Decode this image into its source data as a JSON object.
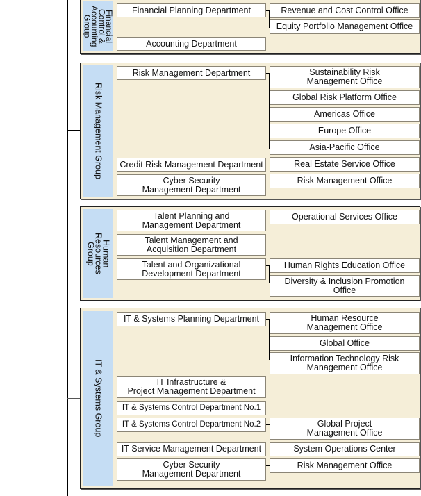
{
  "groups": [
    {
      "name": "Financial\nControl &\nAccounting\nGroup",
      "departments": [
        "Financial Planning Department",
        "Accounting Department"
      ],
      "offices": [
        "Revenue and Cost Control Office",
        "Equity Portfolio Management Office"
      ]
    },
    {
      "name": "Risk Management Group",
      "departments": [
        "Risk Management Department",
        "Credit Risk Management Department",
        "Cyber Security\nManagement Department"
      ],
      "offices": [
        "Sustainability Risk\nManagement Office",
        "Global Risk Platform Office",
        "Americas Office",
        "Europe Office",
        "Asia-Pacific Office",
        "Real Estate Service Office",
        "Risk Management Office"
      ]
    },
    {
      "name": "Human\nResources\nGroup",
      "departments": [
        "Talent Planning  and\nManagement Department",
        "Talent Management and\nAcquisition Department",
        "Talent and Organizational\nDevelopment Department"
      ],
      "offices": [
        "Operational Services Office",
        "Human Rights Education Office",
        "Diversity & Inclusion Promotion\nOffice"
      ]
    },
    {
      "name": "IT & Systems Group",
      "departments": [
        "IT & Systems Planning Department",
        "IT Infrastructure &\nProject Management Department",
        "IT & Systems Control Department No.1",
        "IT & Systems Control Department No.2",
        "IT Service Management Department",
        "Cyber Security\nManagement Department"
      ],
      "offices": [
        "Human Resource\nManagement Office",
        "Global Office",
        "Information Technology Risk\nManagement Office",
        "Global Project\nManagement Office",
        "System Operations Center",
        "Risk Management Office"
      ]
    }
  ],
  "colors": {
    "group_bg": "#f5eed8",
    "label_bg": "#c5ddf4",
    "box_border": "#8b8576"
  }
}
